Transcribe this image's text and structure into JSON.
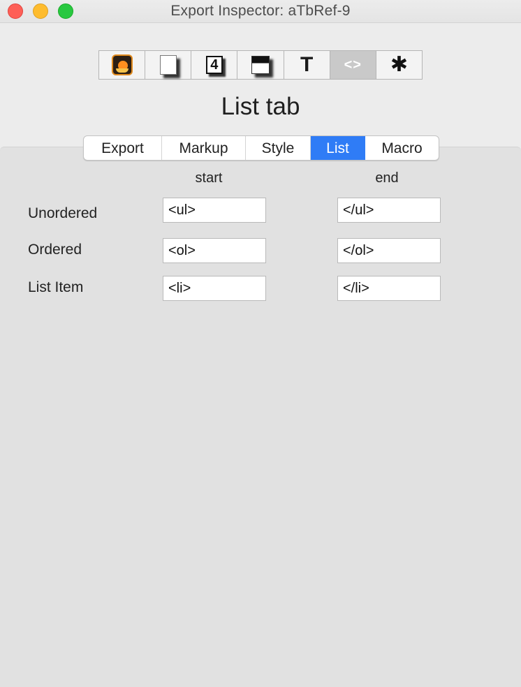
{
  "window": {
    "title": "Export Inspector: aTbRef-9"
  },
  "toolbar": {
    "items": [
      {
        "name": "flame-icon",
        "glyph": ""
      },
      {
        "name": "page-icon",
        "glyph": ""
      },
      {
        "name": "number-icon",
        "glyph": "4"
      },
      {
        "name": "dark-page-icon",
        "glyph": ""
      },
      {
        "name": "text-icon",
        "glyph": "T"
      },
      {
        "name": "code-icon",
        "glyph": "<>"
      },
      {
        "name": "gear-icon",
        "glyph": "✱"
      }
    ],
    "active_index": 5
  },
  "pane": {
    "title": "List tab"
  },
  "tabs": {
    "items": [
      "Export",
      "Markup",
      "Style",
      "List",
      "Macro"
    ],
    "selected": "List"
  },
  "list": {
    "col_start": "start",
    "col_end": "end",
    "rows": [
      {
        "label": "Unordered",
        "start": "<ul>",
        "end": "</ul>"
      },
      {
        "label": "Ordered",
        "start": "<ol>",
        "end": "</ol>"
      },
      {
        "label": "List Item",
        "start": "<li>",
        "end": "</li>"
      }
    ]
  },
  "colors": {
    "accent": "#2f7cf6",
    "close": "#fe5f57",
    "minimize": "#febc2e",
    "maximize": "#28c840"
  }
}
